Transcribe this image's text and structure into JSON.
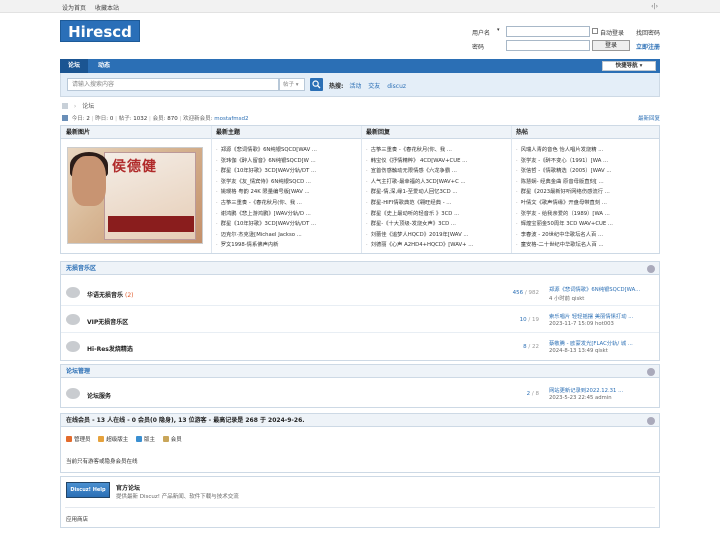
{
  "topbar": {
    "set_home": "设为首页",
    "bookmark": "收藏本站",
    "right_icon": "‹|›"
  },
  "logo": {
    "text": "Hirescd"
  },
  "login": {
    "username_label": "用户名",
    "password_label": "密码",
    "auto_login": "自动登录",
    "forgot": "找回密码",
    "login_btn": "登录",
    "register": "立即注册"
  },
  "nav": {
    "tabs": [
      "论坛",
      "动态"
    ],
    "quick": "快捷导航"
  },
  "search": {
    "placeholder": "请输入搜索内容",
    "type": "帖子",
    "hot_label": "热搜:",
    "hot": [
      "活动",
      "交友",
      "discuz"
    ]
  },
  "breadcrumb": {
    "home_icon": "home-icon",
    "sep": "›",
    "current": "论坛"
  },
  "stats": {
    "today_label": "今日:",
    "today": "2",
    "yesterday_label": "昨日:",
    "yesterday": "0",
    "posts_label": "帖子:",
    "posts": "1032",
    "members_label": "会员:",
    "members": "870",
    "welcome_label": "欢迎新会员:",
    "new_member": "mostafmsd2",
    "new_reply": "最新回复"
  },
  "grid": {
    "headers": [
      "最新图片",
      "最新主题",
      "最新回复",
      "热帖"
    ],
    "latest_topics": [
      "郑源《悲词情歌》6N纯银SQCD[WAV ...",
      "张玮伽《醉人留音》6N纯银SQCD[W ...",
      "群星《10年好歌》3CD[WAV分轨/DT ...",
      "张学友《友_情宾侍》6N纯银SQCD ...",
      "姚璎格 粤韵 24K 限量编号版[WAV ...",
      "古筝三重奏 -《春花秋月(你、我 ...",
      "谢鸿鹏《悲上游鸿鹏》[WAV分轨/D ...",
      "群星《10年好歌》3CD[WAV分轨/DT ...",
      "迈克尔·杰克逊[Michael Jackso ...",
      "罗文1998-情系佛声内新"
    ],
    "latest_replies": [
      "古筝三重奏 -《春花秋月(你、我 ...",
      "韩宝仪《抒情精粹》 4CD[WAV+CUE ...",
      "宣首伤感触动无限情感《六龙争霸 ...",
      "人气主打歌-最幸福的人3CD[WAV+C ...",
      "群星-情,深,缘1-至爱动人回忆3CD ...",
      "群星-HIFI情歌典范《翱旺经典 - ...",
      "群星《史上最动听的轻音乐 》3CD ...",
      "群星-《十大顶级-发烧女声》3CD ...",
      "刘蕾佳《追梦人HQCD》2019年[WAV ...",
      "刘德丽《心声 A2HD4+HQCD》[WAV+ ..."
    ],
    "hot_posts": [
      "风瑞人青的音色 怡人唱片发烧精 ...",
      "张学友 -《醉不变心（1991）[WA ...",
      "张信哲 -《情歌精选（2005）[WAV ...",
      "陈慧娴- 经典金曲 原音母版直刻[ ...",
      "群星《2023最新好听网络伤感流行 ...",
      "叶倩文《歌声情缘》开盘母带直刻 ...",
      "张学友 - 给我亲爱的（1989）[WA ...",
      "辉煌宝丽金50周年 3CD WAV+CUE ...",
      "李春波 - 20世纪中华歌坛名人百 ...",
      "童安格-二十世纪中华歌坛名人百 ..."
    ],
    "picture_text": "侯德健"
  },
  "sections": [
    {
      "title": "无损音乐区",
      "forums": [
        {
          "name": "华语无损音乐",
          "today": "(2)",
          "threads": "456",
          "posts": "982",
          "last": "郑源《悲词情歌》6N纯银SQCD[WA...",
          "time": "4 小时前 qiskt"
        },
        {
          "name": "VIP无损音乐区",
          "today": "",
          "threads": "10",
          "posts": "19",
          "last": "索乐唱片 轻轻摇摆 美丽情愫打动 ...",
          "time": "2023-11-7 15:09 hot003"
        },
        {
          "name": "Hi-Res发烧精选",
          "today": "",
          "threads": "8",
          "posts": "22",
          "last": "蔡敬腾 - 欧蒙发光[FLAC分轨/ 城 ...",
          "time": "2024-8-13 13:49 qiskt"
        }
      ]
    },
    {
      "title": "论坛管理",
      "forums": [
        {
          "name": "论坛服务",
          "today": "",
          "threads": "2",
          "posts": "8",
          "last": "网站更新记录到2022.12.31 ...",
          "time": "2023-5-23 22:45 admin"
        }
      ]
    }
  ],
  "online": {
    "title": "在线会员 - 13 人在线 - 0 会员(0 隐身), 13 位游客 - 最高记录是 268 于 2024-9-26.",
    "legend": [
      {
        "label": "管理员",
        "color": "#e36b2c"
      },
      {
        "label": "超级版主",
        "color": "#e6a23c"
      },
      {
        "label": "版主",
        "color": "#3a8fd1"
      },
      {
        "label": "会员",
        "color": "#c9a65a"
      }
    ],
    "note": "当前只有游客或隐身会员在线"
  },
  "links": {
    "logo_text": "Discuz! Help",
    "name": "官方论坛",
    "desc": "提供最新 Discuz! 产品新闻、软件下载与技术交流",
    "app": "应用商店"
  }
}
